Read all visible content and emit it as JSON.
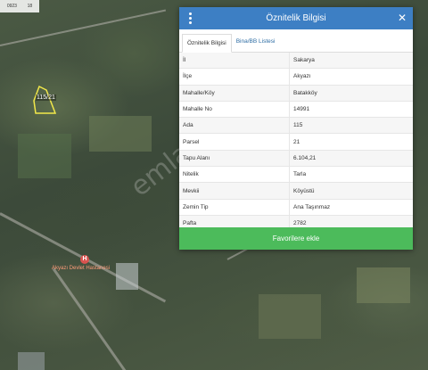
{
  "map": {
    "scale_labels": [
      "0923",
      "18"
    ],
    "parcel_label": "115/21",
    "poi_label": "Akyazı Devlet Hastanesi",
    "poi_marker": "H"
  },
  "panel": {
    "title": "Öznitelik Bilgisi",
    "menu_icon": "vertical-dots-icon",
    "close_icon": "close-icon",
    "tabs": [
      {
        "label": "Öznitelik Bilgisi",
        "active": true
      },
      {
        "label": "Bina/BB Listesi",
        "active": false
      }
    ],
    "rows": [
      {
        "key": "İl",
        "value": "Sakarya"
      },
      {
        "key": "İlçe",
        "value": "Akyazı"
      },
      {
        "key": "Mahalle/Köy",
        "value": "Batakköy"
      },
      {
        "key": "Mahalle No",
        "value": "14991"
      },
      {
        "key": "Ada",
        "value": "115"
      },
      {
        "key": "Parsel",
        "value": "21"
      },
      {
        "key": "Tapu Alanı",
        "value": "6.104,21"
      },
      {
        "key": "Nitelik",
        "value": "Tarla"
      },
      {
        "key": "Mevkii",
        "value": "Köyüstü"
      },
      {
        "key": "Zemin Tip",
        "value": "Ana Taşınmaz"
      },
      {
        "key": "Pafta",
        "value": "2782"
      }
    ],
    "favorite_button": "Favorilere ekle"
  },
  "watermark": "emlakjet.com",
  "colors": {
    "header": "#3d7fc4",
    "button": "#4cbb5b",
    "parcel_outline": "#f2e84a"
  }
}
